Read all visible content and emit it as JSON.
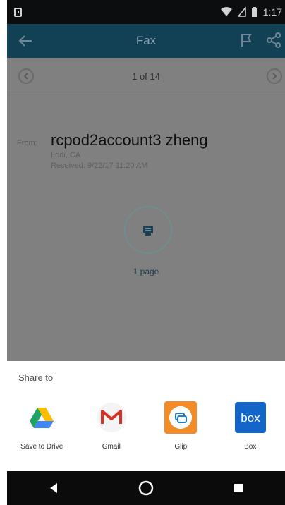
{
  "status_bar": {
    "time": "1:17"
  },
  "app_bar": {
    "title": "Fax"
  },
  "pager": {
    "label": "1 of 14"
  },
  "message": {
    "from_label": "From:",
    "from_name": "rcpod2account3 zheng",
    "location": "Lodi, CA",
    "received": "Received:  9/22/17  11:20 AM",
    "page_count": "1 page"
  },
  "share_sheet": {
    "title": "Share to",
    "targets": [
      {
        "label": "Save to Drive",
        "icon": "google-drive-icon"
      },
      {
        "label": "Gmail",
        "icon": "gmail-icon"
      },
      {
        "label": "Glip",
        "icon": "glip-icon"
      },
      {
        "label": "Box",
        "icon": "box-icon",
        "icon_text": "box"
      }
    ]
  },
  "colors": {
    "app_bar": "#124055",
    "overlay_content": "#808080",
    "glip_orange": "#f28c28",
    "box_blue": "#1366c7"
  }
}
